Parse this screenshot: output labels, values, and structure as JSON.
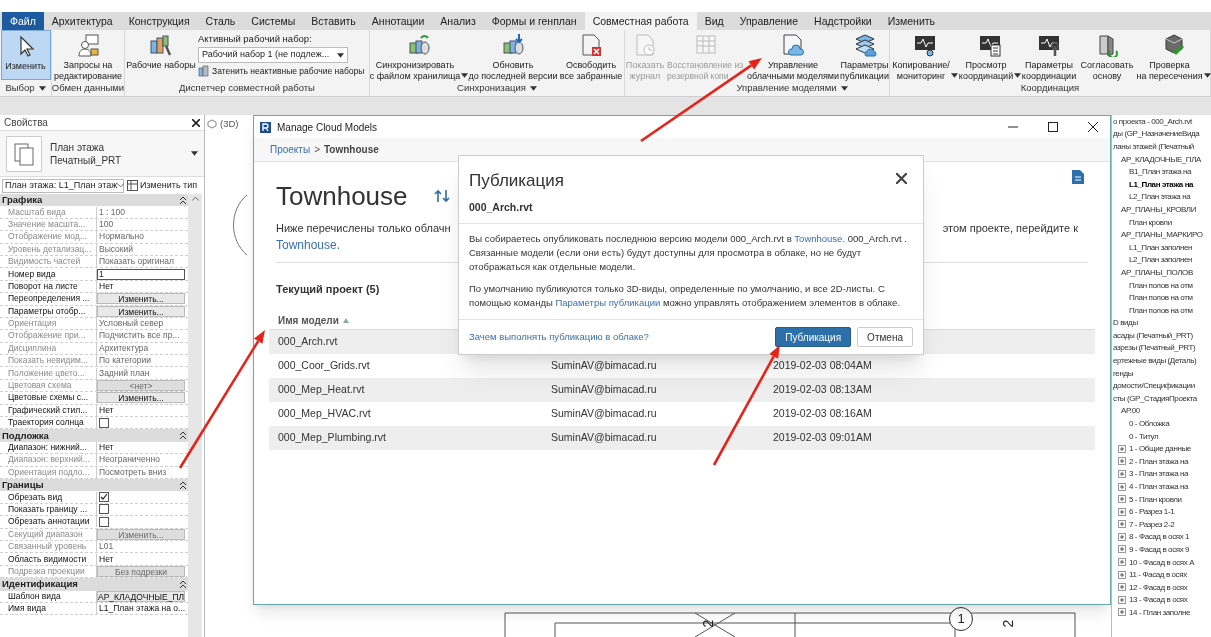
{
  "ribbon": {
    "tabs": [
      {
        "label": "Файл",
        "kind": "file",
        "selected": false
      },
      {
        "label": "Архитектура",
        "kind": "tab",
        "selected": false
      },
      {
        "label": "Конструкция",
        "kind": "tab",
        "selected": false
      },
      {
        "label": "Сталь",
        "kind": "tab",
        "selected": false
      },
      {
        "label": "Системы",
        "kind": "tab",
        "selected": false
      },
      {
        "label": "Вставить",
        "kind": "tab",
        "selected": false
      },
      {
        "label": "Аннотации",
        "kind": "tab",
        "selected": false
      },
      {
        "label": "Анализ",
        "kind": "tab",
        "selected": false
      },
      {
        "label": "Формы и генплан",
        "kind": "tab",
        "selected": false
      },
      {
        "label": "Совместная работа",
        "kind": "tab",
        "selected": true
      },
      {
        "label": "Вид",
        "kind": "tab",
        "selected": false
      },
      {
        "label": "Управление",
        "kind": "tab",
        "selected": false
      },
      {
        "label": "Надстройки",
        "kind": "tab",
        "selected": false
      },
      {
        "label": "Изменить",
        "kind": "tab",
        "selected": false
      }
    ],
    "groups": [
      {
        "label": "Выбор",
        "dropdown": true,
        "buttons": [
          {
            "lines": [
              "Изменить"
            ],
            "selected": true,
            "disabled": false,
            "dropdown": false
          }
        ]
      },
      {
        "label": "Обмен данными",
        "dropdown": false,
        "buttons": [
          {
            "lines": [
              "Запросы на",
              "редактирование"
            ],
            "selected": false,
            "disabled": false,
            "dropdown": false
          }
        ]
      },
      {
        "label": "Диспетчер совместной работы",
        "dropdown": false,
        "buttons": [
          {
            "lines": [
              "Рабочие наборы"
            ],
            "selected": false,
            "disabled": false,
            "dropdown": false
          }
        ],
        "active_workset": {
          "label": "Активный рабочий набор:",
          "value": "Рабочий набор 1 (не подлеж..."
        },
        "gray_inactive": "Затенить неактивные рабочие наборы"
      },
      {
        "label": "Синхронизация",
        "dropdown": true,
        "buttons": [
          {
            "lines": [
              "Синхронизировать",
              "с файлом хранилища"
            ],
            "selected": false,
            "disabled": false,
            "dropdown": true
          },
          {
            "lines": [
              "Обновить",
              "до последней версии"
            ],
            "selected": false,
            "disabled": false,
            "dropdown": false
          },
          {
            "lines": [
              "Освободить",
              "все забранные"
            ],
            "selected": false,
            "disabled": false,
            "dropdown": false
          }
        ]
      },
      {
        "label": "Управление моделями",
        "dropdown": true,
        "buttons": [
          {
            "lines": [
              "Показать",
              "журнал"
            ],
            "selected": false,
            "disabled": true,
            "dropdown": false
          },
          {
            "lines": [
              "Восстановление из",
              "резервной копи"
            ],
            "selected": false,
            "disabled": true,
            "dropdown": false
          },
          {
            "lines": [
              "Управление",
              "облачными моделями"
            ],
            "selected": false,
            "disabled": false,
            "dropdown": false
          },
          {
            "lines": [
              "Параметры",
              "публикации"
            ],
            "selected": false,
            "disabled": false,
            "dropdown": false
          }
        ]
      },
      {
        "label": "Координация",
        "dropdown": false,
        "buttons": [
          {
            "lines": [
              "Копирование/",
              "мониторинг"
            ],
            "selected": false,
            "disabled": false,
            "dropdown": true
          },
          {
            "lines": [
              "Просмотр",
              "координаций"
            ],
            "selected": false,
            "disabled": false,
            "dropdown": true
          },
          {
            "lines": [
              "Параметры",
              "координации"
            ],
            "selected": false,
            "disabled": false,
            "dropdown": false
          },
          {
            "lines": [
              "Согласовать",
              "основу"
            ],
            "selected": false,
            "disabled": false,
            "dropdown": false
          },
          {
            "lines": [
              "Проверка",
              "на пересечения"
            ],
            "selected": false,
            "disabled": false,
            "dropdown": true
          }
        ]
      }
    ]
  },
  "properties": {
    "title": "Свойства",
    "type_selector": {
      "family": "План этажа",
      "type": "Печатный_PRT"
    },
    "instance_selector": "План этажа: L1_План этаж",
    "edit_type": "Изменить тип",
    "sections": [
      {
        "title": "Графика",
        "rows": [
          {
            "label": "Масштаб вида",
            "value": "1 : 100",
            "kind": "text",
            "editable": false
          },
          {
            "label": "Значение масшта...",
            "value": "100",
            "kind": "text",
            "editable": false
          },
          {
            "label": "Отображение мод...",
            "value": "Нормально",
            "kind": "text",
            "editable": false
          },
          {
            "label": "Уровень детализац...",
            "value": "Высокий",
            "kind": "text",
            "editable": false
          },
          {
            "label": "Видимость частей",
            "value": "Показать оригинал",
            "kind": "text",
            "editable": false
          },
          {
            "label": "Номер вида",
            "value": "1",
            "kind": "input",
            "editable": true
          },
          {
            "label": "Поворот на листе",
            "value": "Нет",
            "kind": "text",
            "editable": true
          },
          {
            "label": "Переопределения ...",
            "value": "Изменить...",
            "kind": "button",
            "editable": true
          },
          {
            "label": "Параметры отобр...",
            "value": "Изменить...",
            "kind": "button",
            "editable": true
          },
          {
            "label": "Ориентация",
            "value": "Условный север",
            "kind": "text",
            "editable": false
          },
          {
            "label": "Отображение при...",
            "value": "Подчистить все пр...",
            "kind": "text",
            "editable": false
          },
          {
            "label": "Дисциплина",
            "value": "Архитектура",
            "kind": "text",
            "editable": false
          },
          {
            "label": "Показать невидим...",
            "value": "По категории",
            "kind": "text",
            "editable": false
          },
          {
            "label": "Положение цвето...",
            "value": "Задний план",
            "kind": "text",
            "editable": false
          },
          {
            "label": "Цветовая схема",
            "value": "<нет>",
            "kind": "button",
            "editable": false
          },
          {
            "label": "Цветовые схемы с...",
            "value": "Изменить...",
            "kind": "button",
            "editable": true
          },
          {
            "label": "Графический стил...",
            "value": "Нет",
            "kind": "text",
            "editable": true
          },
          {
            "label": "Траектория солнца",
            "kind": "checkbox",
            "checked": false,
            "editable": true
          }
        ]
      },
      {
        "title": "Подложка",
        "rows": [
          {
            "label": "Диапазон: нижний...",
            "value": "Нет",
            "kind": "text",
            "editable": true
          },
          {
            "label": "Диапазон: верхний...",
            "value": "Неограниченно",
            "kind": "text",
            "editable": false
          },
          {
            "label": "Ориентация подло...",
            "value": "Посмотреть вниз",
            "kind": "text",
            "editable": false
          }
        ]
      },
      {
        "title": "Границы",
        "rows": [
          {
            "label": "Обрезать вид",
            "kind": "checkbox",
            "checked": true,
            "editable": true
          },
          {
            "label": "Показать границу ...",
            "kind": "checkbox",
            "checked": false,
            "editable": true
          },
          {
            "label": "Обрезать аннотации",
            "kind": "checkbox",
            "checked": false,
            "editable": true
          },
          {
            "label": "Секущий диапазон",
            "value": "Изменить...",
            "kind": "button",
            "editable": false
          },
          {
            "label": "Связанный уровень",
            "value": "L01",
            "kind": "text",
            "editable": false
          },
          {
            "label": "Область видимости",
            "value": "Нет",
            "kind": "text",
            "editable": true
          },
          {
            "label": "Подрезка проекции",
            "value": "Без подрезки",
            "kind": "button",
            "editable": false
          }
        ]
      },
      {
        "title": "Идентификация",
        "rows": [
          {
            "label": "Шаблон вида",
            "value": "АР_КЛАДОЧНЫЕ_ПЛ",
            "kind": "button",
            "editable": true
          },
          {
            "label": "Имя вида",
            "value": "L1_План этажа на о...",
            "kind": "text",
            "editable": true
          }
        ]
      }
    ]
  },
  "view": {
    "tab": "(3D)",
    "drawing_labels": [
      "2",
      "1",
      "2"
    ]
  },
  "cloud_dialog": {
    "title": "Manage Cloud Models",
    "breadcrumb": {
      "link": "Проекты",
      "separator": ">",
      "current": "Townhouse"
    },
    "heading": "Townhouse",
    "description_start": "Ниже перечислены только облачн",
    "description_end": "этом проекте, перейдите к",
    "description_link": "Townhouse.",
    "section_title": "Текущий проект (5)",
    "column": "Имя модели",
    "rows": [
      {
        "name": "000_Arch.rvt"
      },
      {
        "name": "000_Coor_Grids.rvt",
        "user": "SuminAV@bimacad.ru",
        "date": "2019-02-03 08:04AM"
      },
      {
        "name": "000_Mep_Heat.rvt",
        "user": "SuminAV@bimacad.ru",
        "date": "2019-02-03 08:13AM"
      },
      {
        "name": "000_Mep_HVAC.rvt",
        "user": "SuminAV@bimacad.ru",
        "date": "2019-02-03 08:16AM"
      },
      {
        "name": "000_Mep_Plumbing.rvt",
        "user": "SuminAV@bimacad.ru",
        "date": "2019-02-03 09:01AM"
      }
    ]
  },
  "publish_modal": {
    "title": "Публикация",
    "file": "000_Arch.rvt",
    "paragraphs": [
      [
        {
          "text": "Вы собираетесь опубликовать последнюю версию модели 000_Arch.rvt в ",
          "link": false
        },
        {
          "text": "Townhouse",
          "link": true
        },
        {
          "text": ". 000_Arch.rvt . Связанные модели (если они есть) будут доступны для просмотра в облаке, но не будут отображаться как отдельные модели.",
          "link": false
        }
      ],
      [
        {
          "text": "По умолчанию публикуются только 3D-виды, определенные по умолчанию, и все 2D-листы. С помощью команды ",
          "link": false
        },
        {
          "text": "Параметры публикации",
          "link": true
        },
        {
          "text": " можно управлять отображением элементов в облаке.",
          "link": false
        }
      ]
    ],
    "help_link": "Зачем выполнять публикацию в облаке?",
    "buttons": [
      {
        "label": "Публикация",
        "kind": "primary"
      },
      {
        "label": "Отмена",
        "kind": "secondary"
      }
    ]
  },
  "project_browser": {
    "tree": [
      {
        "label": "о проекта - 000_Arch.rvt",
        "selected": false
      },
      {
        "label": "ды (GP_НазначениеВида",
        "selected": false
      },
      {
        "label": "ланы этажей (Печатный",
        "selected": false,
        "children": [
          {
            "label": "АР_КЛАДОЧНЫЕ_ПЛА",
            "selected": false,
            "children": [
              {
                "label": "B1_План этажа на",
                "selected": false
              },
              {
                "label": "L1_План этажа на",
                "selected": true
              },
              {
                "label": "L2_План этажа на",
                "selected": false
              }
            ]
          },
          {
            "label": "АР_ПЛАНЫ_КРОВЛИ",
            "selected": false,
            "children": [
              {
                "label": "План кровли",
                "selected": false
              }
            ]
          },
          {
            "label": "АР_ПЛАНЫ_МАРКИРО",
            "selected": false,
            "children": [
              {
                "label": "L1_План заполнен",
                "selected": false
              },
              {
                "label": "L2_План заполнен",
                "selected": false
              }
            ]
          },
          {
            "label": "АР_ПЛАНЫ_ПОЛОВ",
            "selected": false,
            "children": [
              {
                "label": "План полов на отм",
                "selected": false
              },
              {
                "label": "План полов на отм",
                "selected": false
              },
              {
                "label": "План полов на отм",
                "selected": false
              }
            ]
          }
        ]
      },
      {
        "label": "D виды",
        "selected": false
      },
      {
        "label": "асады (Печатный_PRT)",
        "selected": false
      },
      {
        "label": "азрезы (Печатный_PRT)",
        "selected": false
      },
      {
        "label": "ертежные виды (Деталь)",
        "selected": false
      },
      {
        "label": "генды",
        "selected": false
      },
      {
        "label": "домости/Спецификации",
        "selected": false
      },
      {
        "label": "сты (GP_СтадияПроекта",
        "selected": false,
        "children": [
          {
            "label": "AP.00",
            "selected": false,
            "children": [
              {
                "label": "0 - Обложка",
                "selected": false,
                "collapsed": false
              },
              {
                "label": "0 - Титул",
                "selected": false,
                "collapsed": false
              },
              {
                "label": "1 - Общие данные",
                "selected": false,
                "collapsed": true
              },
              {
                "label": "2 - План этажа на",
                "selected": false,
                "collapsed": true
              },
              {
                "label": "3 - План этажа на",
                "selected": false,
                "collapsed": true
              },
              {
                "label": "4 - План этажа на",
                "selected": false,
                "collapsed": true
              },
              {
                "label": "5 - План кровли",
                "selected": false,
                "collapsed": true
              },
              {
                "label": "6 - Разрез 1-1",
                "selected": false,
                "collapsed": true
              },
              {
                "label": "7 - Разрез 2-2",
                "selected": false,
                "collapsed": true
              },
              {
                "label": "8 - Фасад в осях 1",
                "selected": false,
                "collapsed": true
              },
              {
                "label": "9 - Фасад в осях 9",
                "selected": false,
                "collapsed": true
              },
              {
                "label": "10 - Фасад в осях А",
                "selected": false,
                "collapsed": true
              },
              {
                "label": "11 - Фасад в осях",
                "selected": false,
                "collapsed": true
              },
              {
                "label": "12 - Фасад в осях",
                "selected": false,
                "collapsed": true
              },
              {
                "label": "13 - Фасад в осях",
                "selected": false,
                "collapsed": true
              },
              {
                "label": "14 - План заполне",
                "selected": false,
                "collapsed": true
              }
            ]
          }
        ]
      }
    ]
  }
}
